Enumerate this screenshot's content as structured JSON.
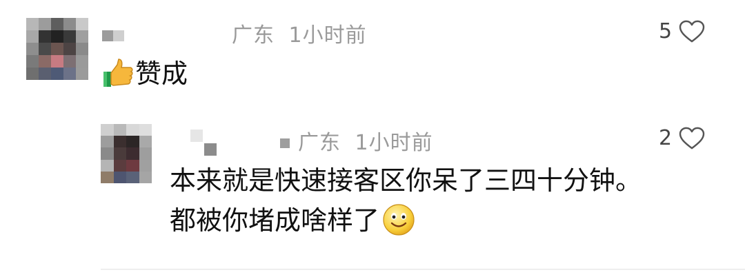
{
  "comment": {
    "location": "广东",
    "time": "1小时前",
    "likes": "5",
    "text": "赞成",
    "emoji": "thumbs-up"
  },
  "reply": {
    "location": "广东",
    "time": "1小时前",
    "likes": "2",
    "text": "本来就是快速接客区你呆了三四十分钟。都被你堵成啥样了",
    "emoji": "smiling-face"
  },
  "colors": {
    "meta": "#9a9a9a",
    "text": "#111111",
    "divider": "#eeeeee"
  }
}
